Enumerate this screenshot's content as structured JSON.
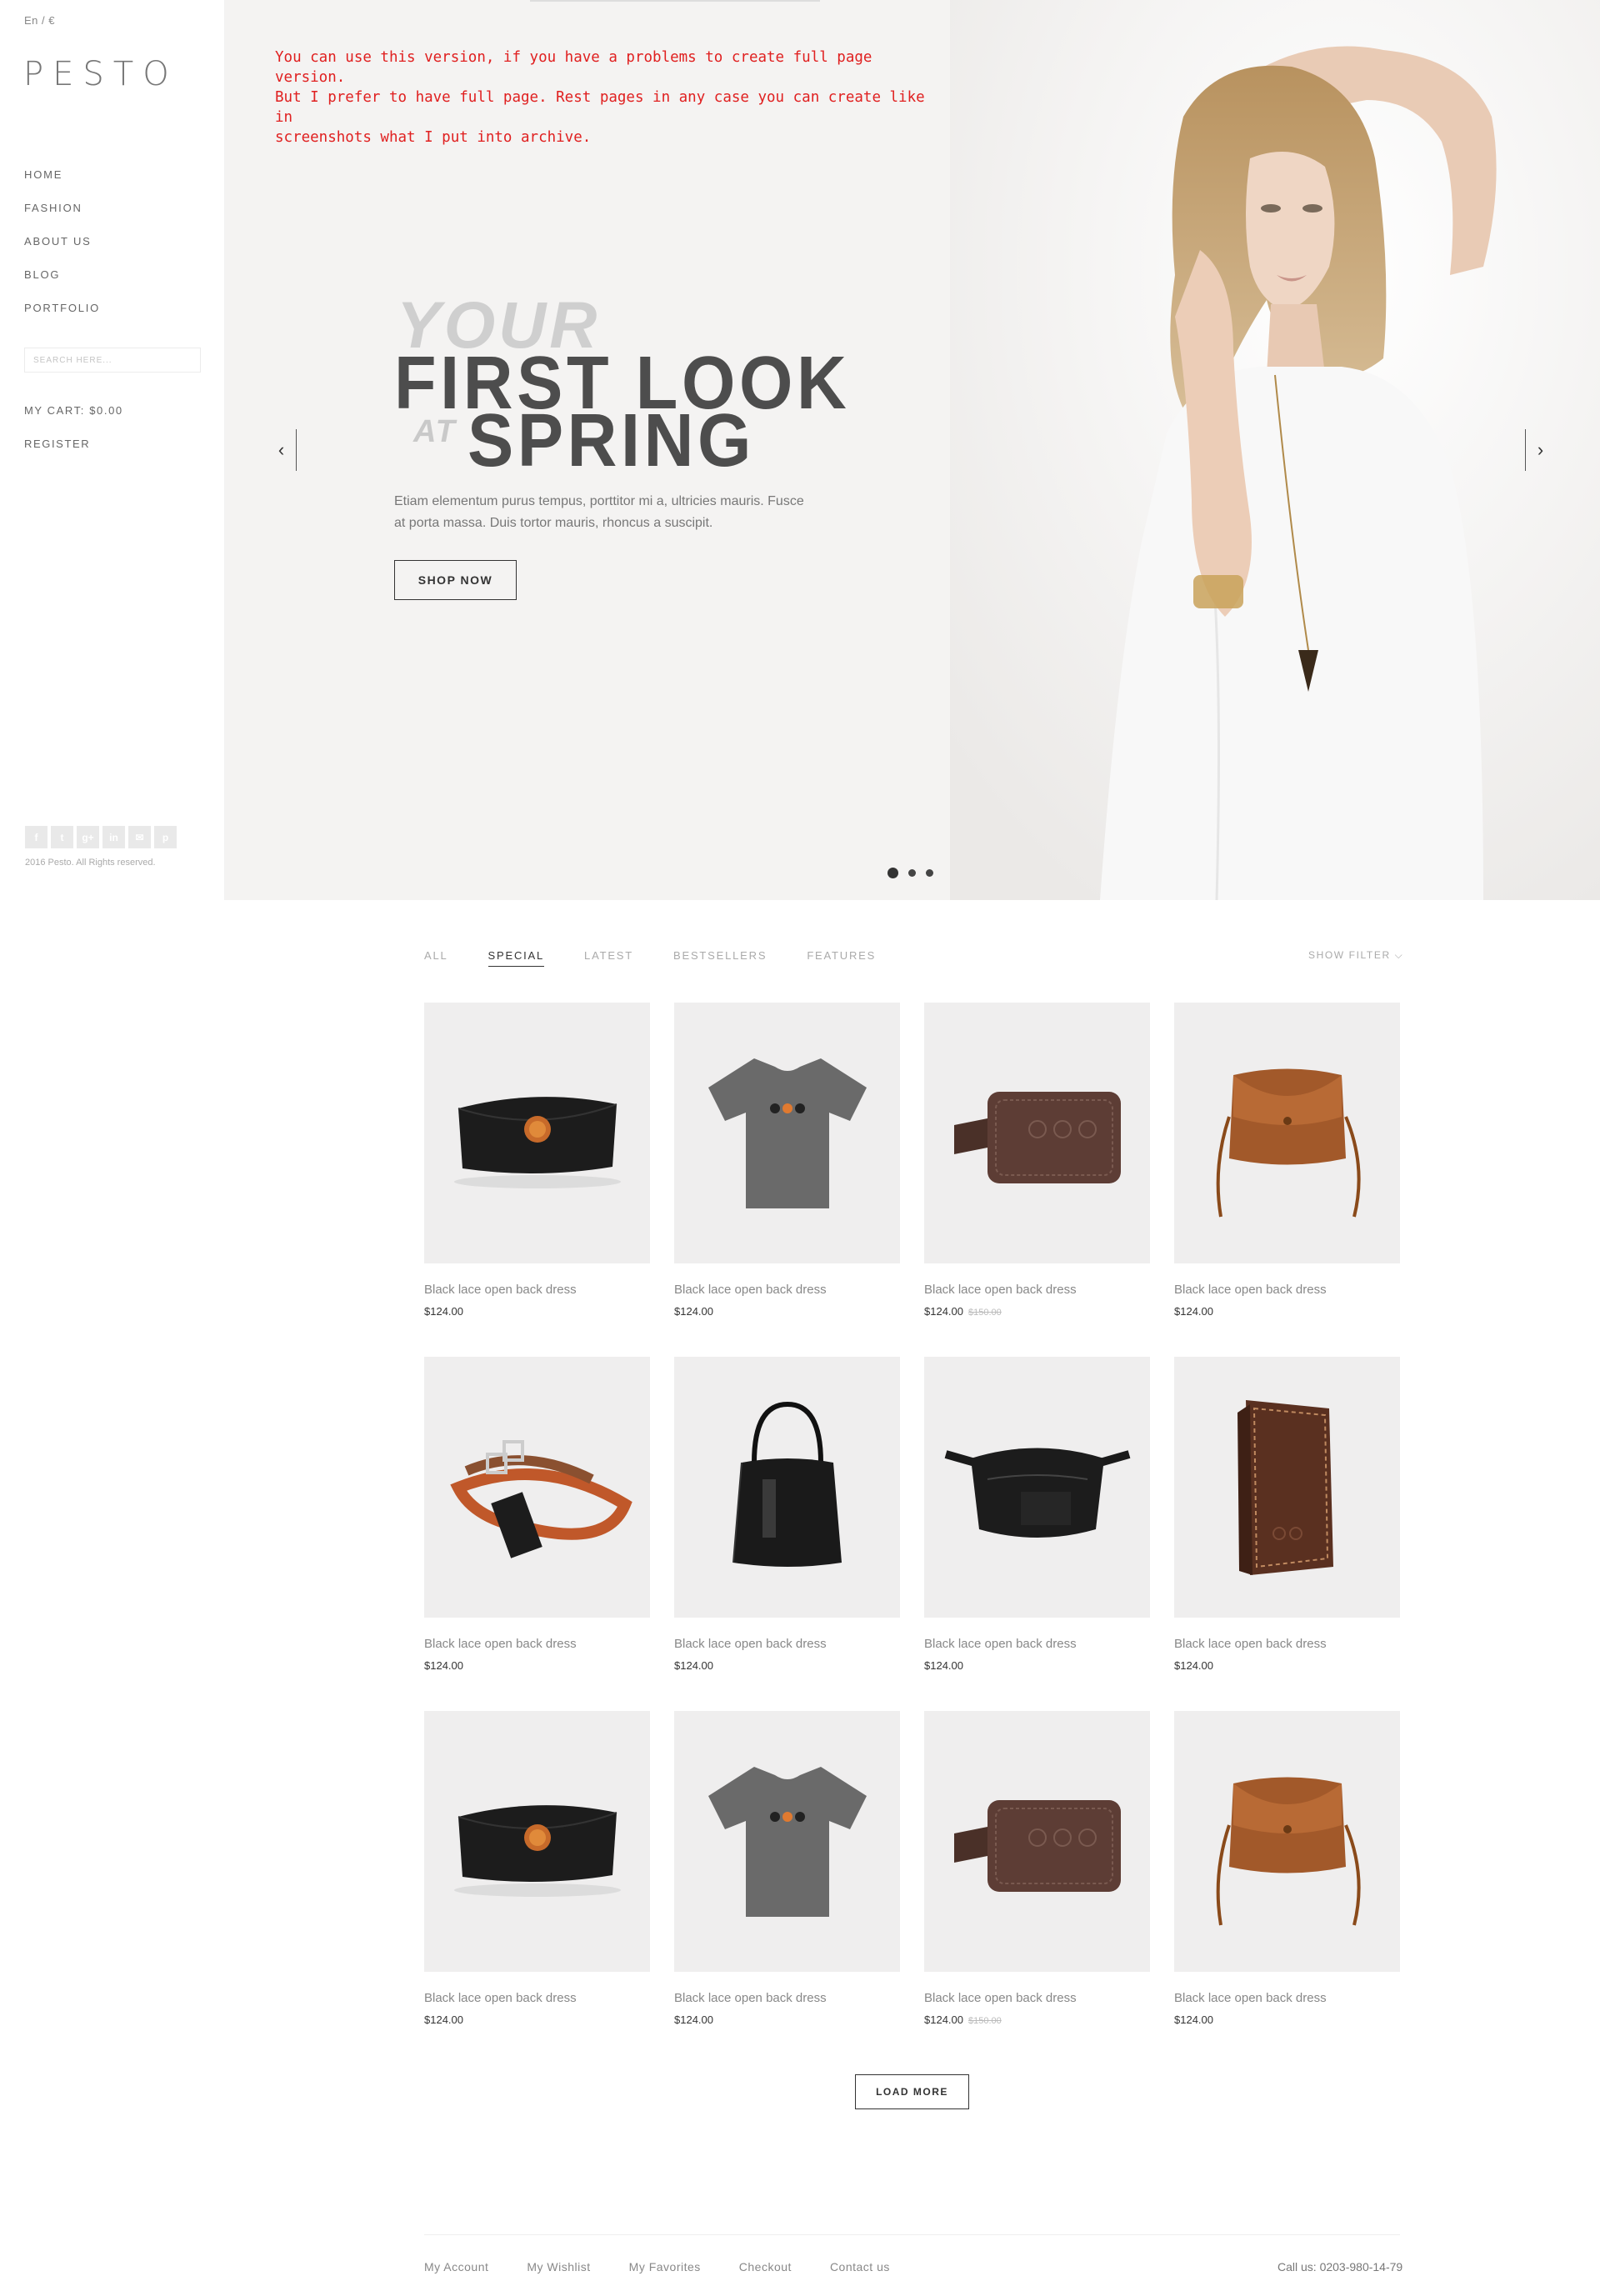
{
  "header": {
    "lang": "En / €",
    "logo": "PESTO"
  },
  "nav": [
    "HOME",
    "FASHION",
    "ABOUT US",
    "BLOG",
    "PORTFOLIO"
  ],
  "search": {
    "placeholder": "SEARCH HERE..."
  },
  "cart": "MY CART: $0.00",
  "register": "REGISTER",
  "socials": [
    "f",
    "t",
    "g+",
    "in",
    "✉",
    "p"
  ],
  "copyright": "2016 Pesto. All Rights reserved.",
  "hero": {
    "note": "You can use this version, if you have a problems to create full page version.\nBut I prefer to have full page. Rest pages in any case you can create like in\nscreenshots what I put into archive.",
    "line1": "YOUR",
    "line2": "FIRST LOOK",
    "line3_small": "AT",
    "line3": "SPRING",
    "description": "Etiam elementum purus tempus, porttitor mi a, ultricies mauris. Fusce at porta massa. Duis tortor mauris, rhoncus a suscipit.",
    "cta": "SHOP NOW",
    "slide_count": 3,
    "active_slide": 1
  },
  "tabs": [
    "ALL",
    "SPECIAL",
    "LATEST",
    "BESTSELLERS",
    "FEATURES"
  ],
  "active_tab": "SPECIAL",
  "show_filter": "SHOW FILTER ⌵",
  "products": [
    {
      "name": "Black lace open back dress",
      "price": "$124.00",
      "old_price": "",
      "image": "black-clutch"
    },
    {
      "name": "Black lace open back dress",
      "price": "$124.00",
      "old_price": "",
      "image": "grey-tshirt"
    },
    {
      "name": "Black lace open back dress",
      "price": "$124.00",
      "old_price": "$150.00",
      "image": "leather-luggage-tag"
    },
    {
      "name": "Black lace open back dress",
      "price": "$124.00",
      "old_price": "",
      "image": "brown-shoulder-bag"
    },
    {
      "name": "Black lace open back dress",
      "price": "$124.00",
      "old_price": "",
      "image": "leather-belts"
    },
    {
      "name": "Black lace open back dress",
      "price": "$124.00",
      "old_price": "",
      "image": "black-handbag"
    },
    {
      "name": "Black lace open back dress",
      "price": "$124.00",
      "old_price": "",
      "image": "black-belt-bag"
    },
    {
      "name": "Black lace open back dress",
      "price": "$124.00",
      "old_price": "",
      "image": "brown-wallet"
    },
    {
      "name": "Black lace open back dress",
      "price": "$124.00",
      "old_price": "",
      "image": "black-clutch"
    },
    {
      "name": "Black lace open back dress",
      "price": "$124.00",
      "old_price": "",
      "image": "grey-tshirt"
    },
    {
      "name": "Black lace open back dress",
      "price": "$124.00",
      "old_price": "$150.00",
      "image": "leather-luggage-tag"
    },
    {
      "name": "Black lace open back dress",
      "price": "$124.00",
      "old_price": "",
      "image": "brown-shoulder-bag"
    }
  ],
  "load_more": "LOAD MORE",
  "footer": {
    "links": [
      "My Account",
      "My Wishlist",
      "My Favorites",
      "Checkout",
      "Contact us"
    ],
    "call": "Call us: 0203-980-14-79"
  },
  "colors": {
    "accent_note": "#e02020",
    "heading": "#4d4d4d",
    "thumb_bg": "#efeeee"
  }
}
